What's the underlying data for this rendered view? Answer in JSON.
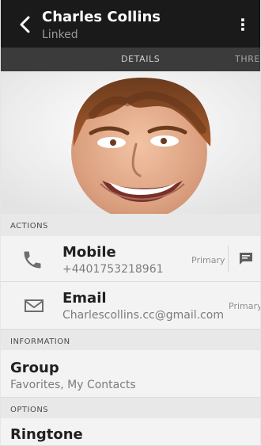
{
  "header": {
    "title": "Charles Collins",
    "subtitle": "Linked"
  },
  "tabs": [
    {
      "label": "DETAILS"
    },
    {
      "label": "THREA"
    }
  ],
  "sections": {
    "actions": "ACTIONS",
    "information": "INFORMATION",
    "options": "OPTIONS"
  },
  "actions": [
    {
      "label": "Mobile",
      "value": "+4401753218961",
      "tag": "Primary"
    },
    {
      "label": "Email",
      "value": "Charlescollins.cc@gmail.com",
      "tag": "Primary"
    }
  ],
  "information": {
    "group_label": "Group",
    "group_value": "Favorites, My Contacts"
  },
  "options": {
    "ringtone_label": "Ringtone"
  }
}
